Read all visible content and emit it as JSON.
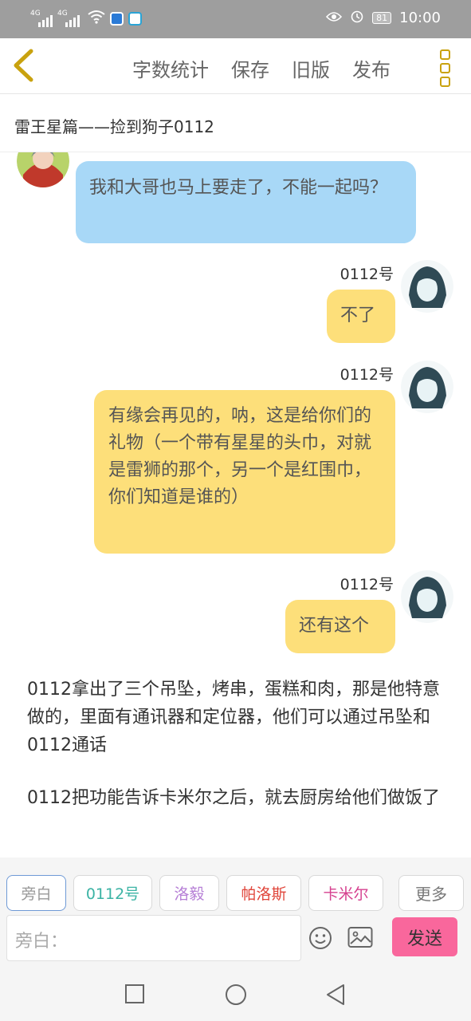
{
  "status_bar": {
    "net1": "4G",
    "net2": "4G",
    "battery": "81",
    "time": "10:00",
    "icons": [
      "signal-icon",
      "wifi-icon",
      "shield-app-icon",
      "app-icon",
      "eye-icon",
      "alarm-icon",
      "battery-icon"
    ]
  },
  "toolbar": {
    "actions": [
      "字数统计",
      "保存",
      "旧版",
      "发布"
    ],
    "icons": [
      "back-icon",
      "more-menu-icon"
    ]
  },
  "title": "雷王星篇——捡到狗子0112",
  "messages": [
    {
      "type": "bubble",
      "side": "left",
      "color": "blue",
      "text": "我和大哥也马上要走了，不能一起吗？"
    },
    {
      "type": "bubble",
      "side": "right",
      "color": "yellow",
      "sender": "0112号",
      "text": "不了"
    },
    {
      "type": "bubble",
      "side": "right",
      "color": "yellow",
      "sender": "0112号",
      "text": "有缘会再见的，呐，这是给你们的礼物（一个带有星星的头巾，对就是雷狮的那个，另一个是红围巾，你们知道是谁的）"
    },
    {
      "type": "bubble",
      "side": "right",
      "color": "yellow",
      "sender": "0112号",
      "text": "还有这个"
    },
    {
      "type": "narration",
      "text": "0112拿出了三个吊坠，烤串，蛋糕和肉，那是他特意做的，里面有通讯器和定位器，他们可以通过吊坠和0112通话"
    },
    {
      "type": "narration",
      "text": "0112把功能告诉卡米尔之后，就去厨房给他们做饭了"
    }
  ],
  "characters": [
    {
      "label": "旁白",
      "color": "#999999"
    },
    {
      "label": "0112号",
      "color": "#3bb3a4"
    },
    {
      "label": "洛毅",
      "color": "#b67fd6"
    },
    {
      "label": "帕洛斯",
      "color": "#e0453a"
    },
    {
      "label": "卡米尔",
      "color": "#d6418f"
    }
  ],
  "more_label": "更多",
  "input": {
    "placeholder": "旁白："
  },
  "send_label": "发送",
  "nav_icons": [
    "recent-apps-icon",
    "home-icon",
    "back-nav-icon"
  ]
}
